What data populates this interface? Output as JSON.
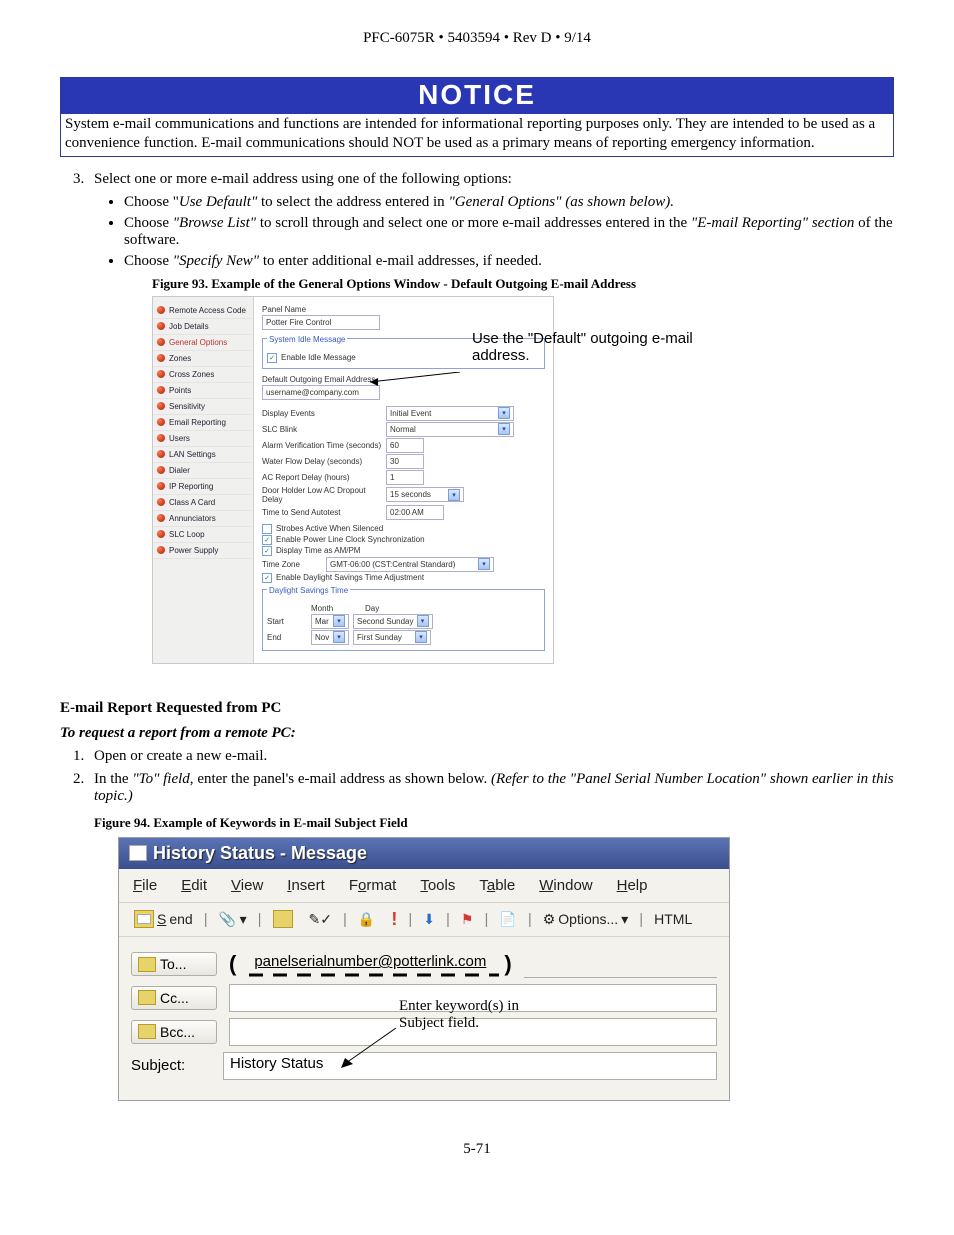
{
  "header": "PFC-6075R • 5403594 • Rev D • 9/14",
  "notice": {
    "title": "NOTICE",
    "body": "System e-mail communications and functions are intended for informational reporting purposes only.  They are intended to be used as a convenience function. E-mail communications should NOT be used as a primary means of reporting emergency information."
  },
  "step3": {
    "num": "3.",
    "text": "Select one or more e-mail address using one of the following options:",
    "bullets": {
      "b1a": "Choose \"",
      "b1b": "Use Default\"",
      "b1c": " to select the address entered in ",
      "b1d": "\"General Options\" (as shown below).",
      "b2a": "Choose ",
      "b2b": "\"Browse List\"",
      "b2c": " to scroll through and select one or more e-mail addresses entered in the ",
      "b2d": "\"E-mail Reporting\" section",
      "b2e": " of the software.",
      "b3a": "Choose ",
      "b3b": "\"Specify New\"",
      "b3c": " to enter additional e-mail addresses, if needed."
    }
  },
  "fig93": {
    "caption": "Figure 93. Example of the General Options Window - Default Outgoing E-mail Address",
    "nav": [
      "Remote Access Code",
      "Job Details",
      "General Options",
      "Zones",
      "Cross Zones",
      "Points",
      "Sensitivity",
      "Email Reporting",
      "Users",
      "LAN Settings",
      "Dialer",
      "IP Reporting",
      "Class A Card",
      "Annunciators",
      "SLC Loop",
      "Power Supply"
    ],
    "panel_name_label": "Panel Name",
    "panel_name_value": "Potter Fire Control",
    "idle_fs": "System Idle Message",
    "idle_cbx": "Enable Idle Message",
    "out_email_label": "Default Outgoing Email Address",
    "out_email_value": "username@company.com",
    "display_events_label": "Display Events",
    "display_events_value": "Initial Event",
    "slc_label": "SLC Blink",
    "slc_value": "Normal",
    "alarm_verif_label": "Alarm Verification Time (seconds)",
    "alarm_verif_value": "60",
    "water_label": "Water Flow Delay (seconds)",
    "water_value": "30",
    "ac_label": "AC Report Delay (hours)",
    "ac_value": "1",
    "door_label": "Door Holder Low AC Dropout Delay",
    "door_value": "15 seconds",
    "autotest_label": "Time to Send Autotest",
    "autotest_value": "02:00 AM",
    "strobes_cbx": "Strobes Active When Silenced",
    "pline_cbx": "Enable Power Line Clock Synchronization",
    "ampm_cbx": "Display Time as AM/PM",
    "tz_label": "Time Zone",
    "tz_value": "GMT-06:00 (CST:Central Standard)",
    "dst_cbx": "Enable Daylight Savings Time Adjustment",
    "dst_fs": "Daylight Savings Time",
    "month_h": "Month",
    "day_h": "Day",
    "start_l": "Start",
    "start_m": "Mar",
    "start_d": "Second Sunday",
    "end_l": "End",
    "end_m": "Nov",
    "end_d": "First Sunday",
    "callout": "Use the \"Default\" outgoing e-mail address."
  },
  "section2": {
    "head": "E-mail Report Requested from PC",
    "subhead": "To request a report from a remote PC:",
    "s1": "Open or create a new e-mail.",
    "s2a": "In the ",
    "s2b": "\"To\" field,",
    "s2c": " enter the panel's e-mail address as shown below. ",
    "s2d": "(Refer to the \"Panel Serial Number Location\" shown earlier in this topic.)"
  },
  "fig94": {
    "caption": "Figure 94. Example of Keywords in E-mail Subject Field",
    "title": "History Status - Message",
    "menu": {
      "file": "File",
      "edit": "Edit",
      "view": "View",
      "insert": "Insert",
      "format": "Format",
      "tools": "Tools",
      "table": "Table",
      "window": "Window",
      "help": "Help"
    },
    "toolbar": {
      "send": "Send",
      "options": "Options...",
      "html": "HTML"
    },
    "to_label": "To...",
    "cc_label": "Cc...",
    "bcc_label": "Bcc...",
    "subject_label": "Subject:",
    "to_value": "panelserialnumber@potterlink.com",
    "subject_value": "History Status",
    "callout": "Enter keyword(s) in Subject field."
  },
  "page_num": "5-71"
}
